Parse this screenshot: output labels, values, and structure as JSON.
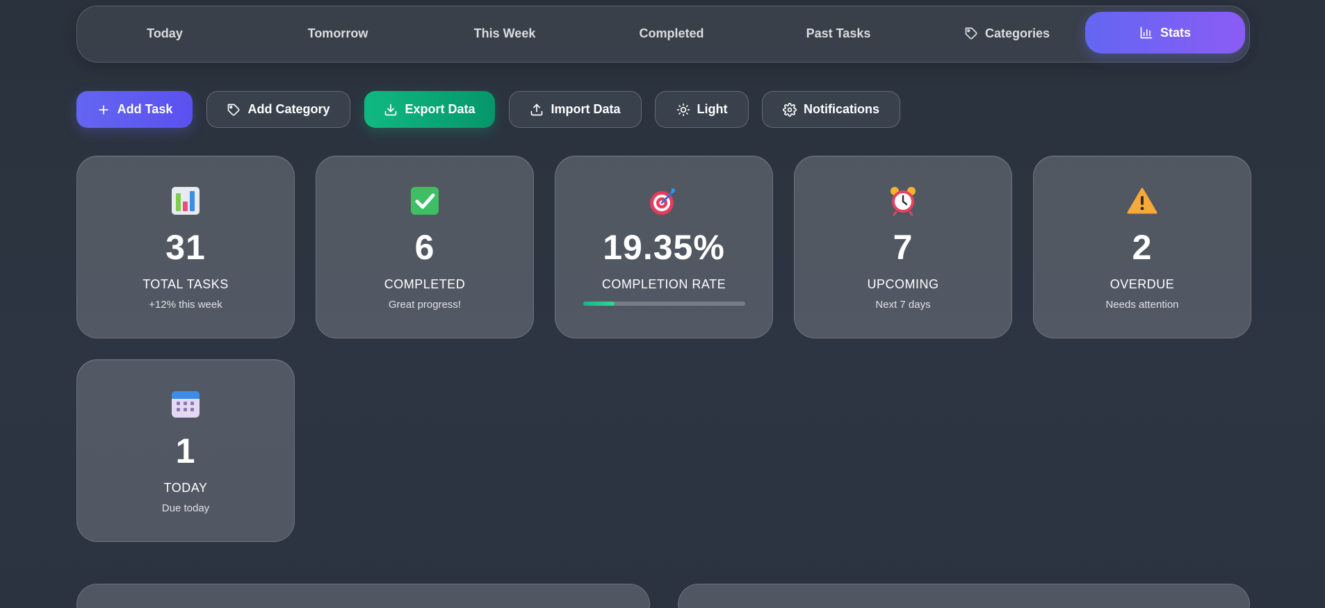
{
  "nav": {
    "items": [
      {
        "label": "Today"
      },
      {
        "label": "Tomorrow"
      },
      {
        "label": "This Week"
      },
      {
        "label": "Completed"
      },
      {
        "label": "Past Tasks"
      },
      {
        "label": "Categories",
        "icon": "tag-icon"
      },
      {
        "label": "Stats",
        "icon": "bar-chart-icon",
        "active": true
      }
    ]
  },
  "toolbar": {
    "add_task": "Add Task",
    "add_category": "Add Category",
    "export_data": "Export Data",
    "import_data": "Import Data",
    "theme_toggle": "Light",
    "notifications": "Notifications"
  },
  "stats": {
    "total": {
      "value": "31",
      "label": "TOTAL TASKS",
      "sublabel": "+12% this week",
      "icon": "bar-chart-emoji"
    },
    "completed": {
      "value": "6",
      "label": "COMPLETED",
      "sublabel": "Great progress!",
      "icon": "check-mark-emoji"
    },
    "rate": {
      "value": "19.35%",
      "label": "COMPLETION RATE",
      "progress_percent": 19.35,
      "icon": "target-emoji"
    },
    "upcoming": {
      "value": "7",
      "label": "UPCOMING",
      "sublabel": "Next 7 days",
      "icon": "alarm-clock-emoji"
    },
    "overdue": {
      "value": "2",
      "label": "OVERDUE",
      "sublabel": "Needs attention",
      "icon": "warning-emoji"
    },
    "today": {
      "value": "1",
      "label": "TODAY",
      "sublabel": "Due today",
      "icon": "calendar-emoji"
    }
  },
  "colors": {
    "accent": "#6366f1",
    "accent_secondary": "#8b5cf6",
    "success": "#10b981",
    "background": "#2d3542"
  }
}
